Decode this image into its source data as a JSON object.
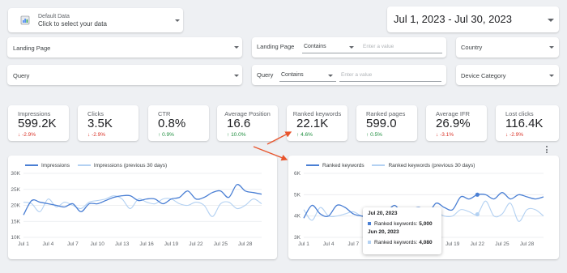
{
  "data_source": {
    "title": "Default Data",
    "subtitle": "Click to select your data",
    "icon": "data-source-icon"
  },
  "date_range": {
    "label": "Jul 1, 2023 - Jul 30, 2023"
  },
  "filters": {
    "landing_page": {
      "label": "Landing Page"
    },
    "landing_page_match": {
      "label": "Landing Page",
      "operator": "Contains",
      "placeholder": "Enter a value"
    },
    "country": {
      "label": "Country"
    },
    "query": {
      "label": "Query"
    },
    "query_match": {
      "label": "Query",
      "operator": "Contains",
      "placeholder": "Enter a value"
    },
    "device_category": {
      "label": "Device Category"
    }
  },
  "kpis": [
    {
      "title": "Impressions",
      "value": "599.2K",
      "delta": "-2.9%",
      "trend": "down"
    },
    {
      "title": "Clicks",
      "value": "3.5K",
      "delta": "-2.9%",
      "trend": "down"
    },
    {
      "title": "CTR",
      "value": "0.8%",
      "delta": "0.9%",
      "trend": "up"
    },
    {
      "title": "Average Position",
      "value": "16.6",
      "delta": "10.0%",
      "trend": "up"
    },
    {
      "title": "Ranked keywords",
      "value": "22.1K",
      "delta": "4.6%",
      "trend": "up"
    },
    {
      "title": "Ranked pages",
      "value": "599.0",
      "delta": "0.5%",
      "trend": "up"
    },
    {
      "title": "Average IFR",
      "value": "26.9%",
      "delta": "-3.1%",
      "trend": "down"
    },
    {
      "title": "Lost clicks",
      "value": "116.4K",
      "delta": "-2.9%",
      "trend": "down"
    }
  ],
  "colors": {
    "current": "#4a7fd4",
    "previous": "#b3d1f2",
    "up": "#1e8e3e",
    "down": "#d93025",
    "annotation_arrow": "#e8552d"
  },
  "chart_data": [
    {
      "type": "line",
      "x_tick_labels": [
        "Jul 1",
        "Jul 4",
        "Jul 7",
        "Jul 10",
        "Jul 13",
        "Jul 16",
        "Jul 19",
        "Jul 22",
        "Jul 25",
        "Jul 28"
      ],
      "y_tick_labels": [
        "30K",
        "25K",
        "20K",
        "15K",
        "10K"
      ],
      "ylim": [
        10000,
        30000
      ],
      "series": [
        {
          "name": "Impressions",
          "values": [
            17000,
            21500,
            21000,
            20500,
            20000,
            19500,
            20500,
            18000,
            20500,
            20500,
            21500,
            22500,
            23000,
            23000,
            21500,
            22000,
            22000,
            20500,
            22000,
            22500,
            24500,
            22000,
            22500,
            24000,
            24500,
            22500,
            26500,
            24500,
            24000,
            23500
          ]
        },
        {
          "name": "Impressions (previous 30 days)",
          "values": [
            21000,
            20500,
            18000,
            22000,
            19500,
            21000,
            20000,
            19000,
            21000,
            21500,
            22000,
            23000,
            22000,
            19000,
            22000,
            21000,
            20500,
            22000,
            22000,
            20500,
            20000,
            21000,
            20000,
            16500,
            20500,
            21000,
            19000,
            20000,
            22000,
            20500
          ]
        }
      ]
    },
    {
      "type": "line",
      "x_tick_labels": [
        "Jul 1",
        "Jul 4",
        "Jul 7",
        "Jul 10",
        "Jul 13",
        "Jul 16",
        "Jul 19",
        "Jul 22",
        "Jul 25",
        "Jul 28"
      ],
      "y_tick_labels": [
        "6K",
        "5K",
        "4K",
        "3K"
      ],
      "ylim": [
        3000,
        6000
      ],
      "series": [
        {
          "name": "Ranked keywords",
          "values": [
            3900,
            4500,
            4100,
            4000,
            4500,
            4400,
            4100,
            4000,
            3950,
            4200,
            4200,
            4500,
            4100,
            4300,
            4400,
            4100,
            4600,
            4400,
            4300,
            4900,
            4800,
            5000,
            5000,
            4800,
            5100,
            4800,
            5000,
            4900,
            4800,
            4900
          ]
        },
        {
          "name": "Ranked keywords (previous 30 days)",
          "values": [
            4300,
            3800,
            4400,
            4000,
            4000,
            4100,
            4200,
            4000,
            4000,
            3800,
            3800,
            4000,
            4150,
            4100,
            4300,
            4200,
            4200,
            4000,
            4000,
            4300,
            4200,
            4080,
            4700,
            4000,
            4100,
            4600,
            3750,
            4300,
            4300,
            4000
          ]
        }
      ],
      "tooltip": {
        "date1": "Jul 20, 2023",
        "label1": "Ranked keywords:",
        "value1": "5,000",
        "date2": "Jun 20, 2023",
        "label2": "Ranked keywords:",
        "value2": "4,080"
      }
    }
  ]
}
